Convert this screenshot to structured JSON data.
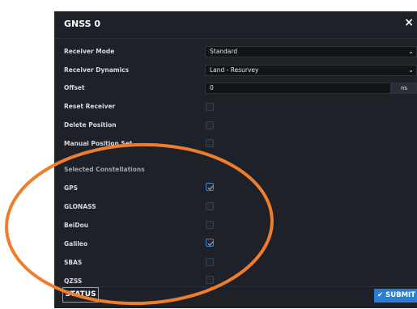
{
  "dialog": {
    "title": "GNSS 0",
    "close_symbol": "×"
  },
  "fields": {
    "receiver_mode": {
      "label": "Receiver Mode",
      "value": "Standard"
    },
    "receiver_dynamics": {
      "label": "Receiver Dynamics",
      "value": "Land - Resurvey"
    },
    "offset": {
      "label": "Offset",
      "value": "0",
      "unit": "ns"
    },
    "reset_receiver": {
      "label": "Reset Receiver",
      "checked": false
    },
    "delete_position": {
      "label": "Delete Position",
      "checked": false
    },
    "manual_position_set": {
      "label": "Manual Position Set",
      "checked": false
    }
  },
  "constellations": {
    "heading": "Selected Constellations",
    "items": [
      {
        "label": "GPS",
        "checked": true
      },
      {
        "label": "GLONASS",
        "checked": false
      },
      {
        "label": "BeiDou",
        "checked": false
      },
      {
        "label": "Galileo",
        "checked": true
      },
      {
        "label": "SBAS",
        "checked": false
      },
      {
        "label": "QZSS",
        "checked": false
      }
    ]
  },
  "footer": {
    "status_label": "STATUS",
    "submit_label": "SUBMIT"
  },
  "colors": {
    "dialog_bg": "#1e2128",
    "accent": "#2a7ed6",
    "annotation": "#ef7d2c"
  },
  "icons": {
    "close": "close-icon",
    "chevron": "chevron-down-icon",
    "check": "check-icon"
  }
}
